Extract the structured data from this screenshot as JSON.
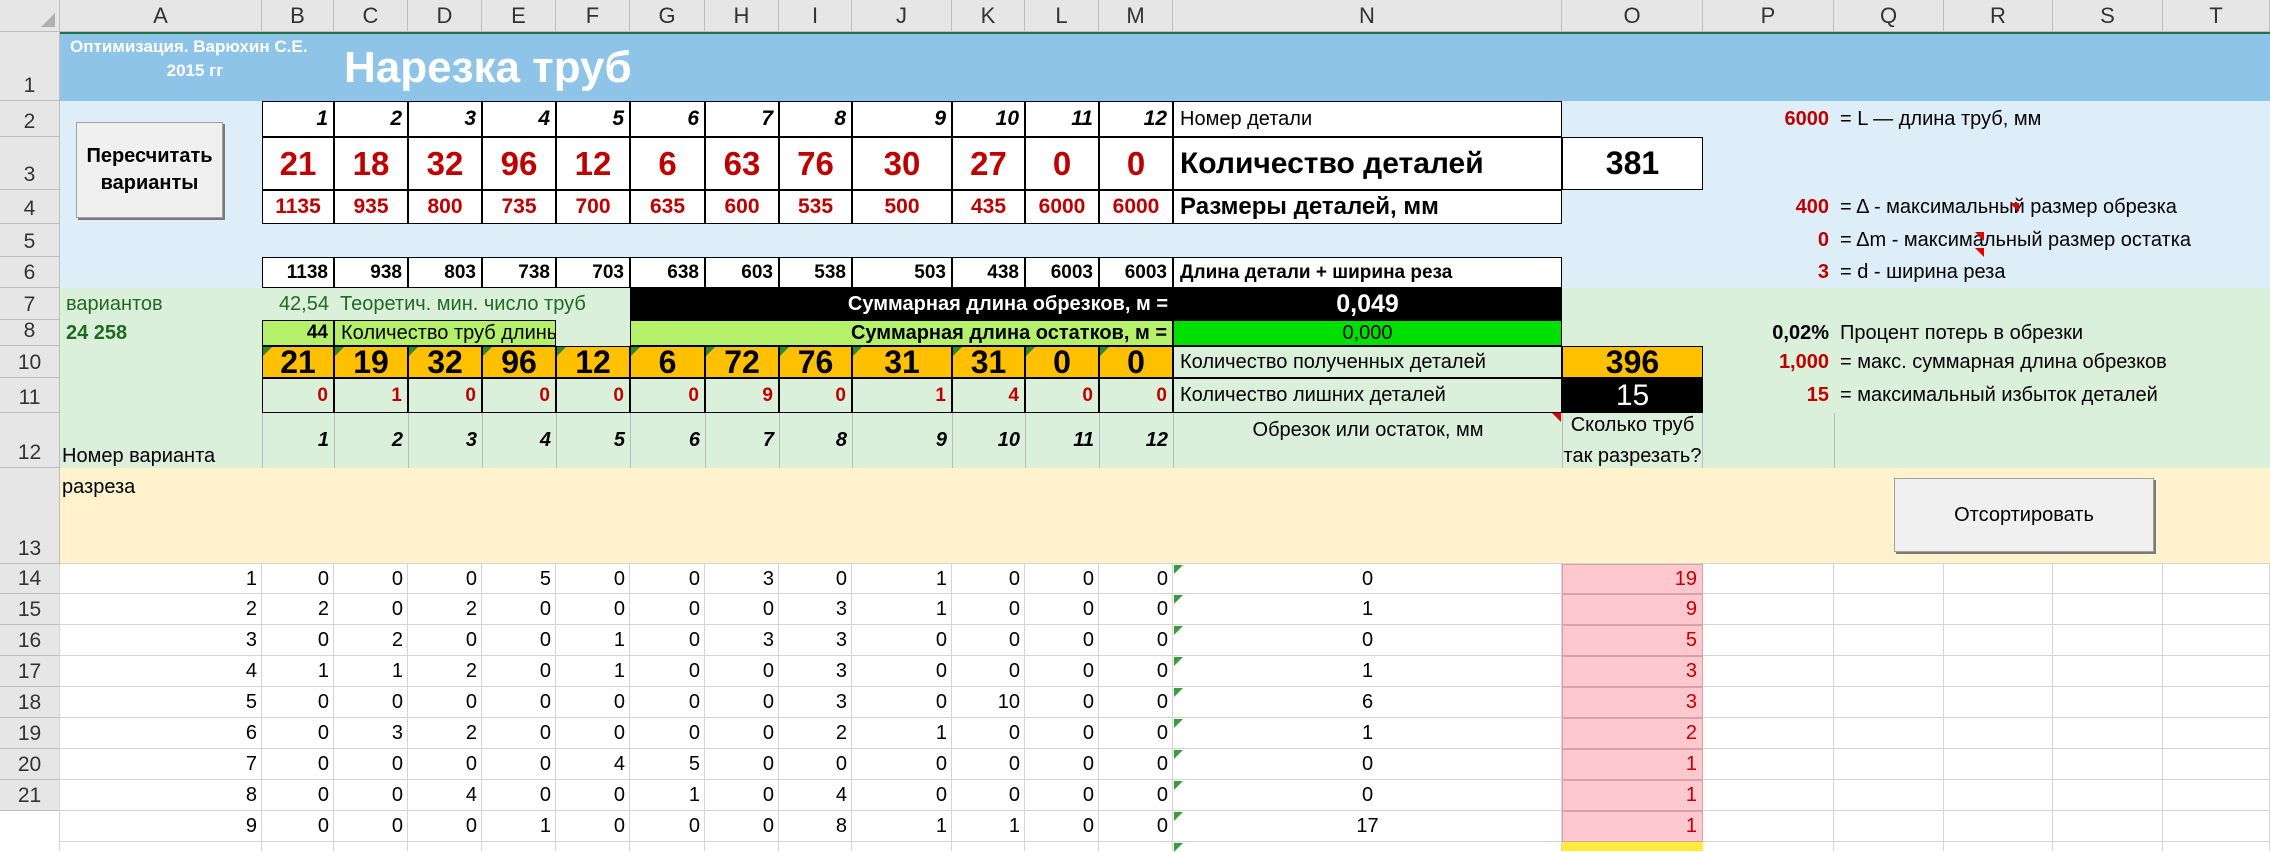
{
  "columns": [
    "A",
    "B",
    "C",
    "D",
    "E",
    "F",
    "G",
    "H",
    "I",
    "J",
    "K",
    "L",
    "M",
    "N",
    "O",
    "P",
    "Q",
    "R",
    "S",
    "T"
  ],
  "rows": [
    "1",
    "2",
    "3",
    "4",
    "5",
    "6",
    "7",
    "8",
    "10",
    "11",
    "12",
    "13",
    "14",
    "15",
    "16",
    "17",
    "18",
    "19",
    "20",
    "21"
  ],
  "header": {
    "author_line1": "Оптимизация.   Варюхин С.Е.",
    "author_line2": "2015 гг",
    "title": "Нарезка труб"
  },
  "buttons": {
    "recalc": "Пересчитать варианты",
    "sort": "Отсортировать"
  },
  "part_numbers": [
    "1",
    "2",
    "3",
    "4",
    "5",
    "6",
    "7",
    "8",
    "9",
    "10",
    "11",
    "12"
  ],
  "part_number_label": "Номер детали",
  "quantities": [
    "21",
    "18",
    "32",
    "96",
    "12",
    "6",
    "63",
    "76",
    "30",
    "27",
    "0",
    "0"
  ],
  "quantity_label": "Количество деталей",
  "quantity_total": "381",
  "sizes": [
    "1135",
    "935",
    "800",
    "735",
    "700",
    "635",
    "600",
    "535",
    "500",
    "435",
    "6000",
    "6000"
  ],
  "size_label": "Размеры деталей, мм",
  "lengths_with_cut": [
    "1138",
    "938",
    "803",
    "738",
    "703",
    "638",
    "603",
    "538",
    "503",
    "438",
    "6003",
    "6003"
  ],
  "length_with_cut_label": "Длина детали + ширина реза",
  "params": [
    {
      "value": "6000",
      "label": "= L — длина труб, мм"
    },
    {
      "value": "400",
      "label": "= Δ - максимальный размер обрезка"
    },
    {
      "value": "0",
      "label": "= Δm - максимальный размер остатка"
    },
    {
      "value": "3",
      "label": "= d - ширина реза"
    }
  ],
  "variants_label": "вариантов",
  "variants_count": "24 258",
  "theor_min_value": "42,54",
  "theor_min_label": "Теоретич. мин. число труб",
  "pipes_count": "44",
  "pipes_label": "Количество труб длины L",
  "trim_sum_label": "Суммарная длина обрезков, м =",
  "trim_sum_value": "0,049",
  "rest_sum_label": "Суммарная длина остатков, м =",
  "rest_sum_value": "0,000",
  "loss_percent": "0,02%",
  "loss_label": "Процент потерь в обрезки",
  "obtained": [
    "21",
    "19",
    "32",
    "96",
    "12",
    "6",
    "72",
    "76",
    "31",
    "31",
    "0",
    "0"
  ],
  "obtained_label": "Количество полученных  деталей",
  "obtained_total": "396",
  "extra": [
    "0",
    "1",
    "0",
    "0",
    "0",
    "0",
    "9",
    "0",
    "1",
    "4",
    "0",
    "0"
  ],
  "extra_label": "Количество лишних деталей",
  "extra_total": "15",
  "max_trim": {
    "value": "1,000",
    "label": "= макс. суммарная длина обрезков"
  },
  "max_extra": {
    "value": "15",
    "label": "= максимальный избыток деталей"
  },
  "table_header": {
    "variant_label": "Номер варианта разреза",
    "cols": [
      "1",
      "2",
      "3",
      "4",
      "5",
      "6",
      "7",
      "8",
      "9",
      "10",
      "11",
      "12"
    ],
    "trim_label": "Обрезок или остаток, мм",
    "howmany_label": "Сколько труб так разрезать?"
  },
  "table_rows": [
    {
      "n": "1",
      "vals": [
        "0",
        "0",
        "0",
        "5",
        "0",
        "0",
        "3",
        "0",
        "1",
        "0",
        "0",
        "0"
      ],
      "trim": "0",
      "count": "19"
    },
    {
      "n": "2",
      "vals": [
        "2",
        "0",
        "2",
        "0",
        "0",
        "0",
        "0",
        "3",
        "1",
        "0",
        "0",
        "0"
      ],
      "trim": "1",
      "count": "9"
    },
    {
      "n": "3",
      "vals": [
        "0",
        "2",
        "0",
        "0",
        "1",
        "0",
        "3",
        "3",
        "0",
        "0",
        "0",
        "0"
      ],
      "trim": "0",
      "count": "5"
    },
    {
      "n": "4",
      "vals": [
        "1",
        "1",
        "2",
        "0",
        "1",
        "0",
        "0",
        "3",
        "0",
        "0",
        "0",
        "0"
      ],
      "trim": "1",
      "count": "3"
    },
    {
      "n": "5",
      "vals": [
        "0",
        "0",
        "0",
        "0",
        "0",
        "0",
        "0",
        "3",
        "0",
        "10",
        "0",
        "0"
      ],
      "trim": "6",
      "count": "3"
    },
    {
      "n": "6",
      "vals": [
        "0",
        "3",
        "2",
        "0",
        "0",
        "0",
        "0",
        "2",
        "1",
        "0",
        "0",
        "0"
      ],
      "trim": "1",
      "count": "2"
    },
    {
      "n": "7",
      "vals": [
        "0",
        "0",
        "0",
        "0",
        "4",
        "5",
        "0",
        "0",
        "0",
        "0",
        "0",
        "0"
      ],
      "trim": "0",
      "count": "1"
    },
    {
      "n": "8",
      "vals": [
        "0",
        "0",
        "4",
        "0",
        "0",
        "1",
        "0",
        "4",
        "0",
        "0",
        "0",
        "0"
      ],
      "trim": "0",
      "count": "1"
    },
    {
      "n": "9",
      "vals": [
        "0",
        "0",
        "0",
        "1",
        "0",
        "0",
        "0",
        "8",
        "1",
        "1",
        "0",
        "0"
      ],
      "trim": "17",
      "count": "1"
    }
  ],
  "colors": {
    "title_bg": "#8dc4e8",
    "info_bg": "#ddeef8",
    "green_bg": "#dbf0da",
    "yellow_bg": "#fff2cc",
    "orange": "#ffc000",
    "pink": "#ffc7ce",
    "lime": "#b4f06a",
    "bright_green": "#00e000",
    "red_text": "#c00000"
  }
}
